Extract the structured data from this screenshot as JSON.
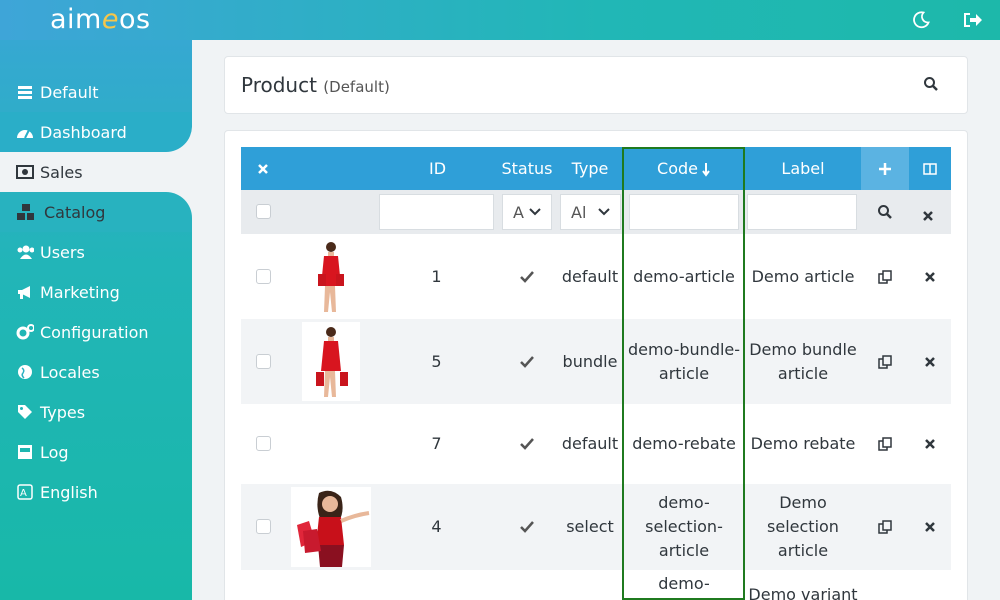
{
  "app": {
    "logo_main": "aim",
    "logo_accent": "e",
    "logo_tail": "os"
  },
  "topbar": {
    "theme_icon": "moon-icon",
    "logout_icon": "logout-icon"
  },
  "sidebar": {
    "items": [
      {
        "label": "Default",
        "icon": "server-icon"
      },
      {
        "label": "Dashboard",
        "icon": "gauge-icon"
      },
      {
        "label": "Sales",
        "icon": "money-icon"
      },
      {
        "label": "Catalog",
        "icon": "cubes-icon"
      },
      {
        "label": "Users",
        "icon": "users-icon"
      },
      {
        "label": "Marketing",
        "icon": "megaphone-icon"
      },
      {
        "label": "Configuration",
        "icon": "cogs-icon"
      },
      {
        "label": "Locales",
        "icon": "globe-icon"
      },
      {
        "label": "Types",
        "icon": "tag-icon"
      },
      {
        "label": "Log",
        "icon": "inbox-icon"
      },
      {
        "label": "English",
        "icon": "language-icon"
      }
    ],
    "active": "Catalog"
  },
  "page": {
    "title": "Product",
    "subtitle": "(Default)"
  },
  "table": {
    "headers": {
      "id": "ID",
      "status": "Status",
      "type": "Type",
      "code": "Code",
      "label": "Label"
    },
    "filters": {
      "status_value": "A",
      "type_value": "Al"
    },
    "rows": [
      {
        "id": "1",
        "status": "✔",
        "type": "default",
        "code": "demo-article",
        "label": "Demo article",
        "thumb": "woman-standing"
      },
      {
        "id": "5",
        "status": "✔",
        "type": "bundle",
        "code": "demo-bundle-\narticle",
        "code_l1": "demo-bundle-",
        "code_l2": "article",
        "label_l1": "Demo bundle",
        "label_l2": "article",
        "thumb": "woman-standing"
      },
      {
        "id": "7",
        "status": "✔",
        "type": "default",
        "code": "demo-rebate",
        "label": "Demo rebate"
      },
      {
        "id": "4",
        "status": "✔",
        "type": "select",
        "code_l1": "demo-",
        "code_l2": "selection-",
        "code_l3": "article",
        "label_l1": "Demo",
        "label_l2": "selection",
        "label_l3": "article",
        "thumb": "woman-portrait"
      },
      {
        "code_l1": "demo-",
        "label_l1": "Demo variant"
      }
    ]
  }
}
